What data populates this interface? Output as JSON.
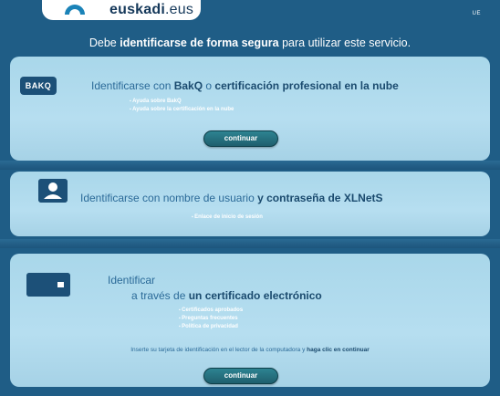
{
  "header": {
    "logo_brand": "euskadi",
    "logo_suffix": ".eus",
    "language_link": "UE"
  },
  "intro": {
    "prefix": "Debe ",
    "bold": "identificarse de forma segura",
    "suffix": " para utilizar este servicio."
  },
  "bakq": {
    "icon_text": "BAKQ",
    "heading_prefix": "Identificarse con ",
    "heading_bold1": "BakQ",
    "heading_mid": " o ",
    "heading_bold2": "certificación profesional en la nube",
    "links": [
      "Ayuda sobre BakQ",
      "Ayuda sobre la certificación en la nube"
    ],
    "button_label": "continuar"
  },
  "xlnets": {
    "heading_prefix": "Identificarse con nombre de usuario ",
    "heading_bold": "y contraseña de XLNetS",
    "links": [
      "Enlace de inicio de sesión"
    ]
  },
  "certificate": {
    "heading_line1": "Identificar",
    "heading_line2_prefix": "a través de ",
    "heading_line2_bold": "un certificado electrónico",
    "links": [
      "Certificados aprobados",
      "Preguntas frecuentes",
      "Política de privacidad"
    ],
    "instruction_prefix": "Inserte su tarjeta de identificación en el lector de la computadora y ",
    "instruction_bold": "haga clic en continuar",
    "button_label": "continuar"
  },
  "colors": {
    "background": "#1f5d86",
    "panel": "#b1dbee",
    "accent_text": "#2b6a98",
    "button": "#2a7a88"
  },
  "icons": [
    "euskadi-logo-icon",
    "bakq-icon",
    "user-icon",
    "card-icon"
  ]
}
